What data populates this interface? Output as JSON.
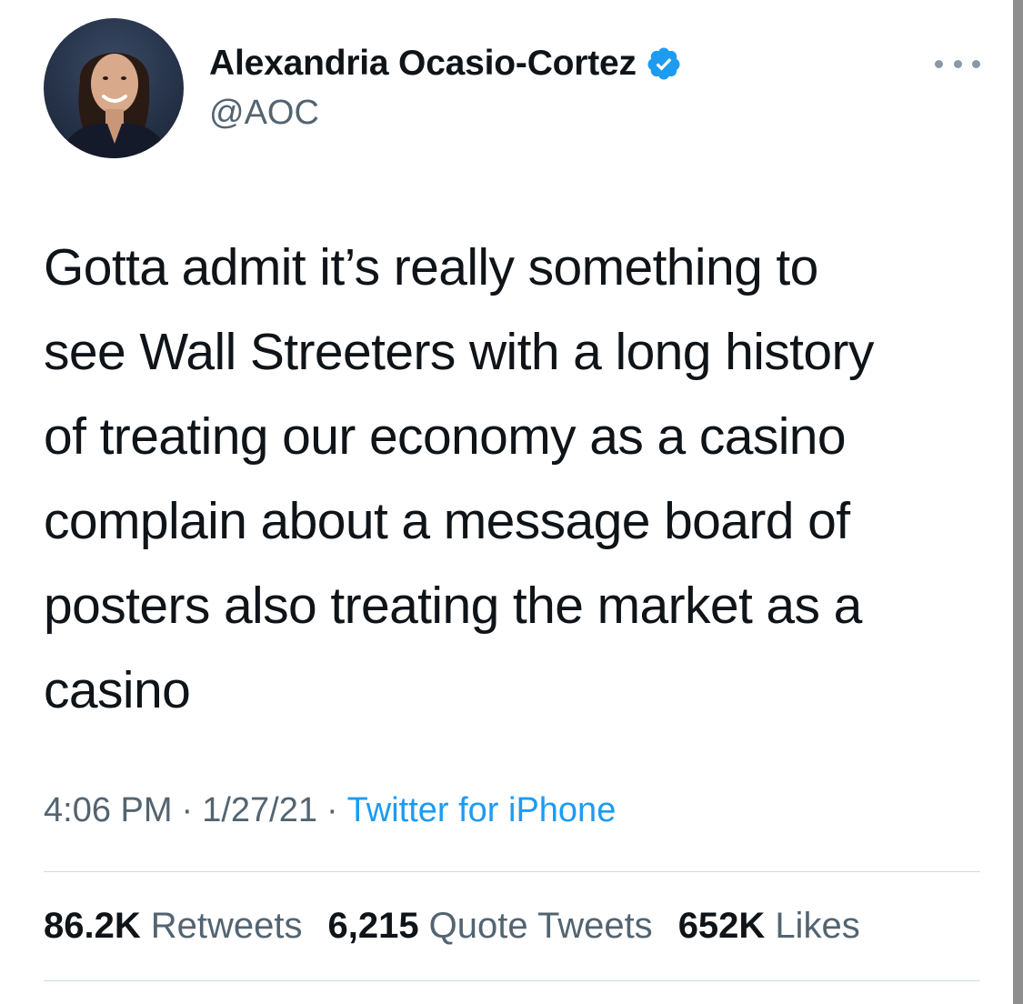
{
  "author": {
    "display_name": "Alexandria Ocasio-Cortez",
    "handle": "@AOC",
    "verified": true
  },
  "tweet": {
    "text": "Gotta admit it’s really something to\nsee Wall Streeters with a long history\nof treating our economy as a casino\ncomplain about a message board of\nposters also treating the market as a\ncasino"
  },
  "meta": {
    "time": "4:06 PM",
    "separator": "·",
    "date": "1/27/21",
    "source": "Twitter for iPhone"
  },
  "stats": {
    "retweets": {
      "count": "86.2K",
      "label": "Retweets"
    },
    "quote_tweets": {
      "count": "6,215",
      "label": "Quote Tweets"
    },
    "likes": {
      "count": "652K",
      "label": "Likes"
    }
  },
  "icons": {
    "verified": "verified-badge-icon",
    "more": "more-options-icon"
  },
  "colors": {
    "accent": "#1d9bf0",
    "text_primary": "#0f1419",
    "text_secondary": "#536471",
    "divider": "#cfd9de"
  }
}
